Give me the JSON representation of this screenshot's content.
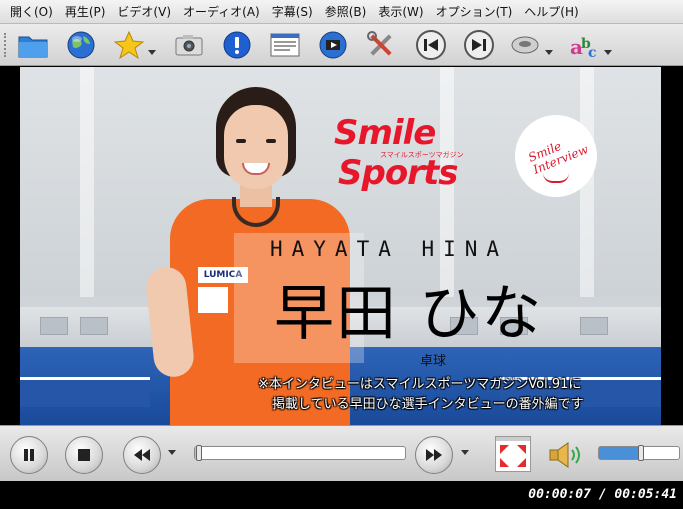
{
  "menu": [
    "開く(O)",
    "再生(P)",
    "ビデオ(V)",
    "オーディオ(A)",
    "字幕(S)",
    "参照(B)",
    "表示(W)",
    "オプション(T)",
    "ヘルプ(H)"
  ],
  "toolbar": {
    "icons": [
      "folder-icon",
      "globe-icon",
      "star-icon",
      "camera-icon",
      "info-icon",
      "document-icon",
      "film-icon",
      "tools-icon",
      "previous-icon",
      "next-icon",
      "disc-icon",
      "subtitles-icon"
    ]
  },
  "video": {
    "brand_line1": "Smile",
    "brand_line2": "Sports",
    "brand_kana": "スマイルスポーツマガジン",
    "badge_text": "Smile Interview",
    "name_latin": "HAYATA HINA",
    "name_jp": "早田 ひな",
    "sport": "卓球",
    "note_line1": "※本インタビューはスマイルスポーツマガジンVol.91に",
    "note_line2": "掲載している早田ひな選手インタビューの番外編です",
    "shirt_logo": "LUMICA",
    "colors": {
      "brand_red": "#e8162b",
      "shirt_orange": "#f26a24",
      "floor_blue": "#2d64b8"
    }
  },
  "controls": {
    "seek_progress": 0.02,
    "volume_level": 0.52
  },
  "status": {
    "time": "00:00:07 / 00:05:41"
  }
}
